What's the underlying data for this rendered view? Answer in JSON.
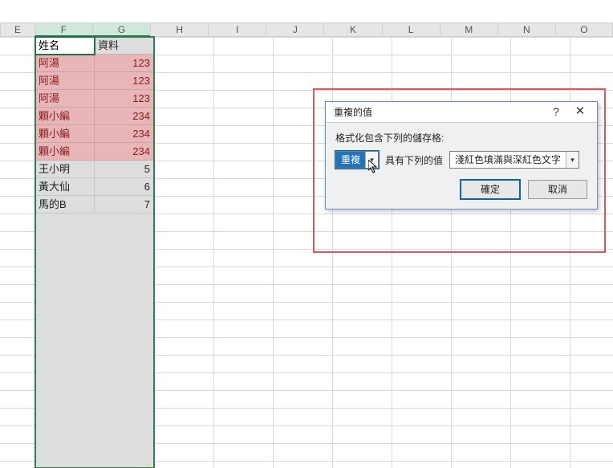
{
  "columns": [
    "E",
    "F",
    "G",
    "H",
    "I",
    "J",
    "K",
    "L",
    "M",
    "N",
    "O"
  ],
  "selected_cols": [
    "F",
    "G"
  ],
  "table": {
    "headers": {
      "name": "姓名",
      "data": "資料"
    },
    "rows": [
      {
        "name": "阿湯",
        "val": "123",
        "dup": true
      },
      {
        "name": "阿湯",
        "val": "123",
        "dup": true
      },
      {
        "name": "阿湯",
        "val": "123",
        "dup": true
      },
      {
        "name": "顆小編",
        "val": "234",
        "dup": true
      },
      {
        "name": "顆小編",
        "val": "234",
        "dup": true
      },
      {
        "name": "顆小編",
        "val": "234",
        "dup": true
      },
      {
        "name": "王小明",
        "val": "5",
        "dup": false
      },
      {
        "name": "黃大仙",
        "val": "6",
        "dup": false
      },
      {
        "name": "馬的B",
        "val": "7",
        "dup": false
      }
    ]
  },
  "dialog": {
    "title": "重複的值",
    "help_label": "?",
    "close_label": "✕",
    "body_label": "格式化包含下列的儲存格:",
    "combo1": "重複",
    "mid_label": "具有下列的值",
    "combo2": "淺紅色填滿與深紅色文字",
    "ok": "確定",
    "cancel": "取消"
  }
}
